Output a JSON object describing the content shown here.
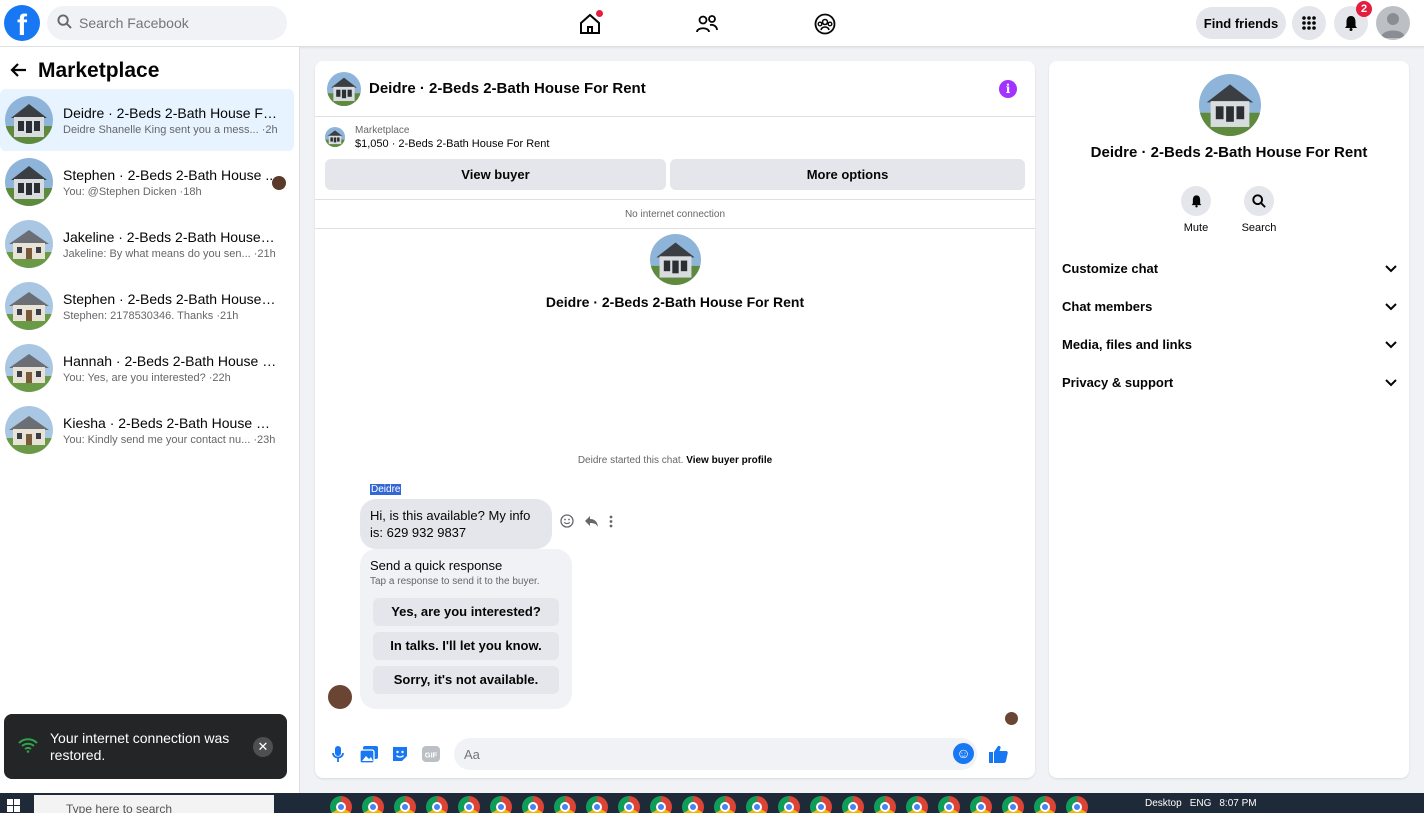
{
  "topbar": {
    "search_placeholder": "Search Facebook",
    "find_friends_label": "Find friends",
    "notification_count": "2",
    "icons": [
      "facebook-logo-icon",
      "search-icon",
      "home-icon",
      "friends-icon",
      "groups-icon",
      "menu-grid-icon",
      "bell-icon",
      "profile-avatar-icon"
    ]
  },
  "sidebar": {
    "title": "Marketplace",
    "conversations": [
      {
        "title": "Deidre · 2-Beds 2-Bath House For ...",
        "subtitle": "Deidre Shanelle King sent you a mess... ·2h"
      },
      {
        "title": "Stephen · 2-Beds 2-Bath House ...",
        "subtitle": "You: @Stephen Dicken ·18h"
      },
      {
        "title": "Jakeline · 2-Beds 2-Bath House For...",
        "subtitle": "Jakeline: By what means do you sen... ·21h"
      },
      {
        "title": "Stephen · 2-Beds 2-Bath House Fo...",
        "subtitle": "Stephen: 2178530346. Thanks ·21h"
      },
      {
        "title": "Hannah · 2-Beds 2-Bath House For...",
        "subtitle": "You: Yes, are you interested? ·22h"
      },
      {
        "title": "Kiesha · 2-Beds 2-Bath House For ...",
        "subtitle": "You: Kindly send me your contact nu... ·23h"
      }
    ]
  },
  "toast": {
    "text": "Your internet connection was restored."
  },
  "chat": {
    "header_title": "Deidre · 2-Beds 2-Bath House For Rent",
    "listing_label": "Marketplace",
    "listing_detail": "$1,050 · 2-Beds 2-Bath House For Rent",
    "view_buyer_label": "View buyer",
    "more_options_label": "More options",
    "connection_status": "No internet connection",
    "center_title": "Deidre · 2-Beds 2-Bath House For Rent",
    "started_text": "Deidre started this chat.",
    "view_profile_label": "View buyer profile",
    "sender_name": "Deidre",
    "message_text": "Hi, is this available? My info is: 629 932 9837",
    "quick_response_title": "Send a quick response",
    "quick_response_sub": "Tap a response to send it to the buyer.",
    "quick_responses": [
      "Yes, are you interested?",
      "In talks. I'll let you know.",
      "Sorry, it's not available."
    ],
    "composer_placeholder": "Aa"
  },
  "right_panel": {
    "title": "Deidre · 2-Beds 2-Bath House For Rent",
    "mute_label": "Mute",
    "search_label": "Search",
    "sections": [
      "Customize chat",
      "Chat members",
      "Media, files and links",
      "Privacy & support"
    ]
  },
  "taskbar": {
    "search_placeholder": "Type here to search",
    "desktop_label": "Desktop",
    "language": "ENG",
    "time": "8:07 PM"
  },
  "colors": {
    "accent": "#1877f2",
    "info": "#a033ff",
    "notification": "#e41e3f"
  }
}
